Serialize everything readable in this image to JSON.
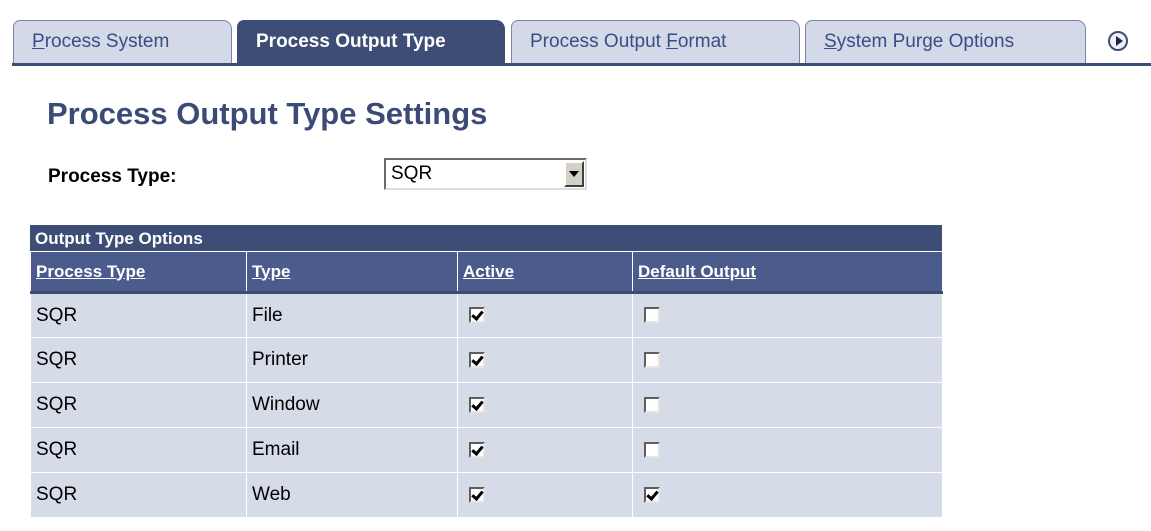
{
  "tabs": [
    {
      "pre": "",
      "ul": "P",
      "post": "rocess System",
      "active": false
    },
    {
      "pre": "Process Output Type",
      "ul": "",
      "post": "",
      "active": true
    },
    {
      "pre": "Process Output ",
      "ul": "F",
      "post": "ormat",
      "active": false
    },
    {
      "pre": "",
      "ul": "S",
      "post": "ystem Purge Options",
      "active": false
    }
  ],
  "tab_scroll_icon": "circle-right-arrow-icon",
  "title": "Process Output Type Settings",
  "process_type": {
    "label": "Process Type:",
    "value": "SQR"
  },
  "grid": {
    "caption": "Output Type Options",
    "headers": [
      "Process Type",
      "Type",
      "Active",
      "Default Output"
    ],
    "rows": [
      {
        "process_type": "SQR",
        "type": "File",
        "active": true,
        "default": false
      },
      {
        "process_type": "SQR",
        "type": "Printer",
        "active": true,
        "default": false
      },
      {
        "process_type": "SQR",
        "type": "Window",
        "active": true,
        "default": false
      },
      {
        "process_type": "SQR",
        "type": "Email",
        "active": true,
        "default": false
      },
      {
        "process_type": "SQR",
        "type": "Web",
        "active": true,
        "default": true
      }
    ]
  },
  "colors": {
    "accent": "#3d4d75",
    "tab_inactive": "#d3d9e8",
    "row_bg": "#d6dbe8",
    "title": "#3b4a76"
  }
}
